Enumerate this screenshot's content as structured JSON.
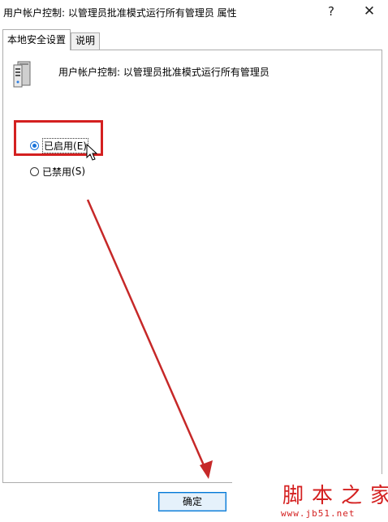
{
  "window": {
    "title": "用户帐户控制: 以管理员批准模式运行所有管理员 属性",
    "help_glyph": "?",
    "close_glyph": "✕"
  },
  "tabs": [
    {
      "label": "本地安全设置",
      "active": true
    },
    {
      "label": "说明",
      "active": false
    }
  ],
  "policy": {
    "icon": "server-icon",
    "title": "用户帐户控制: 以管理员批准模式运行所有管理员"
  },
  "options": {
    "enabled": {
      "label": "已启用",
      "accesskey": "(E)",
      "selected": true
    },
    "disabled": {
      "label": "已禁用",
      "accesskey": "(S)",
      "selected": false
    }
  },
  "buttons": {
    "ok": "确定"
  },
  "annotation": {
    "highlight_color": "#d42020",
    "arrow_color": "#c62828"
  },
  "watermark": {
    "text": "脚本之家",
    "url": "www.jb51.net"
  }
}
